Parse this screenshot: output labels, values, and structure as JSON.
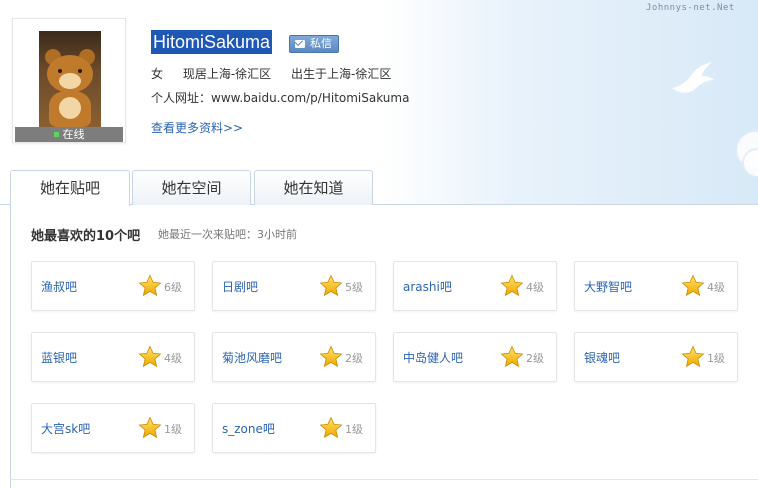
{
  "watermark": "Johnnys-net.Net",
  "profile": {
    "username": "HitomiSakuma",
    "message_button": "私信",
    "online_status": "在线",
    "gender": "女",
    "residence": "现居上海-徐汇区",
    "birthplace": "出生于上海-徐汇区",
    "website": "个人网址：www.baidu.com/p/HitomiSakuma",
    "more_link": "查看更多资料>>"
  },
  "tabs": [
    {
      "label": "她在贴吧",
      "active": true
    },
    {
      "label": "她在空间",
      "active": false
    },
    {
      "label": "她在知道",
      "active": false
    }
  ],
  "section": {
    "title": "她最喜欢的10个吧",
    "last_visit": "她最近一次来贴吧：3小时前"
  },
  "forums": [
    {
      "name": "渔叔吧",
      "level": "6级"
    },
    {
      "name": "日剧吧",
      "level": "5级"
    },
    {
      "name": "arashi吧",
      "level": "4级"
    },
    {
      "name": "大野智吧",
      "level": "4级"
    },
    {
      "name": "蓝银吧",
      "level": "4级"
    },
    {
      "name": "菊池风磨吧",
      "level": "2级"
    },
    {
      "name": "中岛健人吧",
      "level": "2级"
    },
    {
      "name": "银魂吧",
      "level": "1级"
    },
    {
      "name": "大宫sk吧",
      "level": "1级"
    },
    {
      "name": "s_zone吧",
      "level": "1级"
    }
  ],
  "colors": {
    "link": "#2d64b3",
    "username_highlight": "#1f57b5",
    "star": "#f5c116"
  }
}
